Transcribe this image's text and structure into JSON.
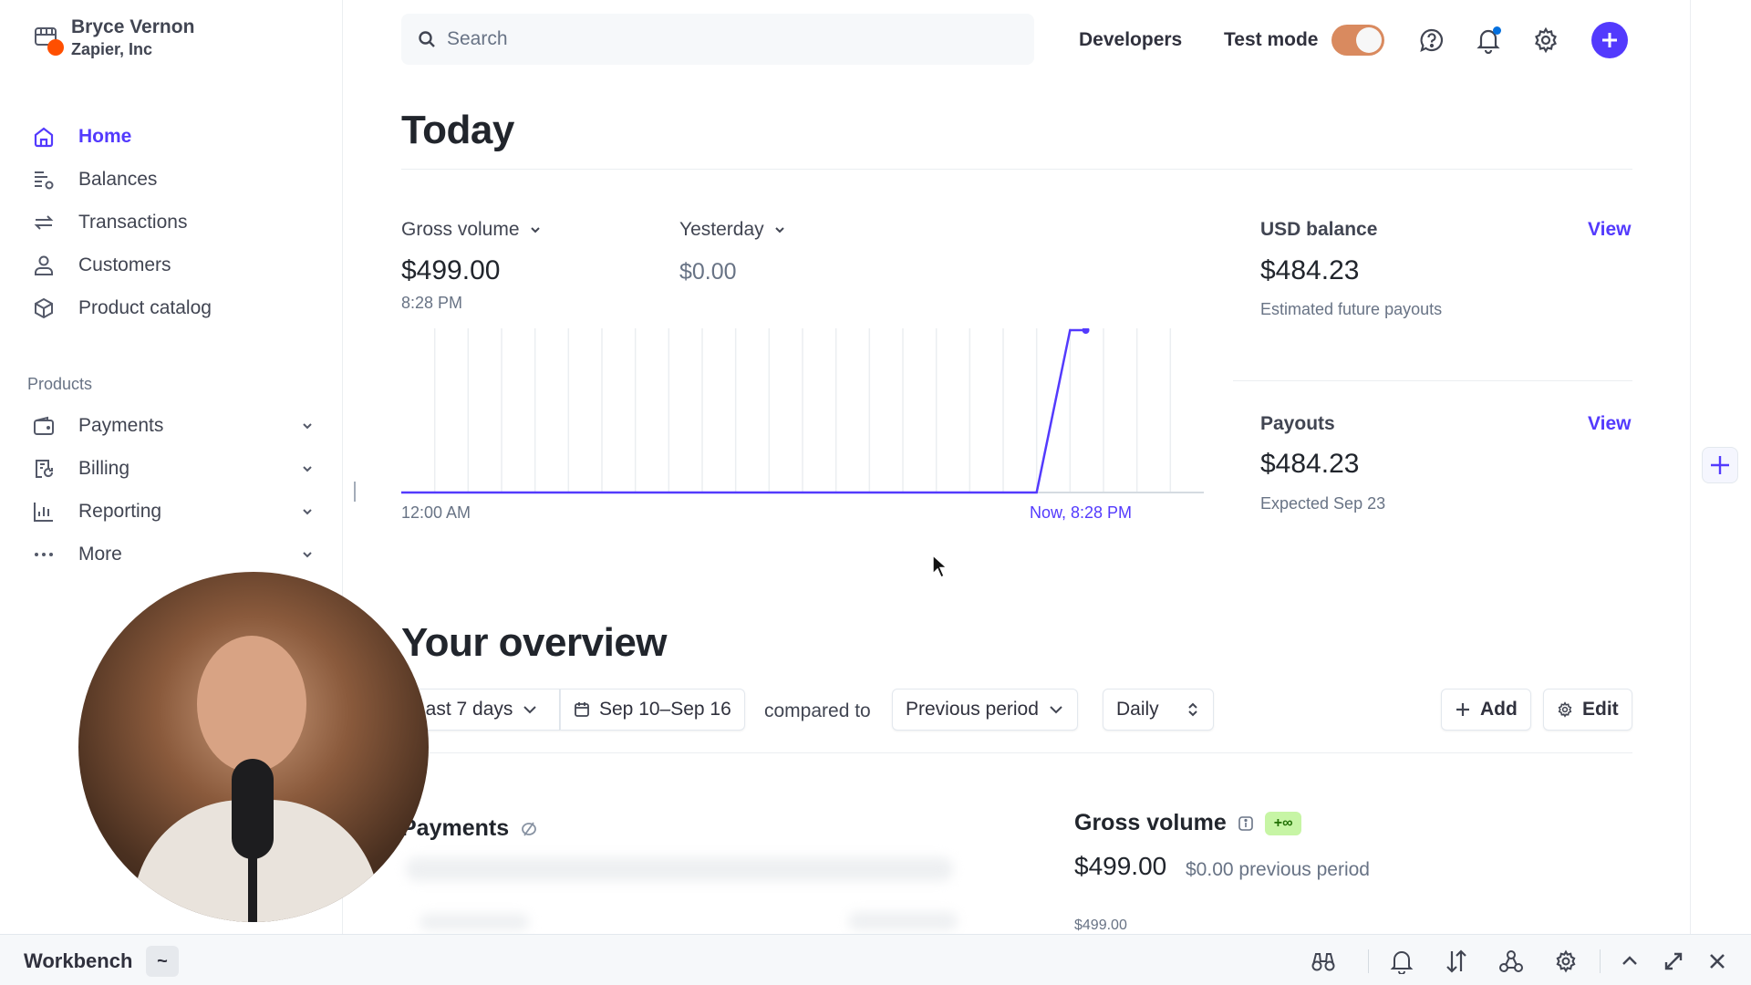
{
  "account": {
    "name": "Bryce Vernon",
    "org": "Zapier, Inc",
    "icon": "store-icon"
  },
  "sidebar": {
    "items": [
      {
        "label": "Home",
        "icon": "home-icon",
        "active": true
      },
      {
        "label": "Balances",
        "icon": "balances-icon"
      },
      {
        "label": "Transactions",
        "icon": "arrows-swap-icon"
      },
      {
        "label": "Customers",
        "icon": "person-icon"
      },
      {
        "label": "Product catalog",
        "icon": "box-icon"
      }
    ],
    "products_label": "Products",
    "products": [
      {
        "label": "Payments",
        "icon": "wallet-icon"
      },
      {
        "label": "Billing",
        "icon": "invoice-icon"
      },
      {
        "label": "Reporting",
        "icon": "bar-chart-icon"
      },
      {
        "label": "More",
        "icon": "more-dots-icon"
      }
    ]
  },
  "topbar": {
    "search_placeholder": "Search",
    "developers": "Developers",
    "test_mode": "Test mode",
    "test_mode_on": true,
    "icons": [
      "help-icon",
      "bell-icon",
      "gear-icon",
      "plus-icon"
    ],
    "accent": "#533afd",
    "toggle_color": "#d98a5f"
  },
  "today": {
    "title": "Today",
    "metric_label": "Gross volume",
    "metric_value": "$499.00",
    "metric_time": "8:28 PM",
    "compare_label": "Yesterday",
    "compare_value": "$0.00",
    "usd_balance": {
      "label": "USD balance",
      "value": "$484.23",
      "sub": "Estimated future payouts",
      "link": "View"
    },
    "payouts": {
      "label": "Payouts",
      "value": "$484.23",
      "sub": "Expected Sep 23",
      "link": "View"
    }
  },
  "chart_data": {
    "type": "line",
    "title": "Gross volume (today)",
    "xlabel": "",
    "ylabel": "",
    "x_tick_labels": [
      "12:00 AM",
      "Now, 8:28 PM"
    ],
    "x_unit": "hour of day",
    "xlim": [
      0,
      24
    ],
    "ylim": [
      0,
      499
    ],
    "grid": "vertical hourly",
    "series": [
      {
        "name": "Gross volume",
        "color": "#533afd",
        "x": [
          0,
          19,
          20,
          20.47
        ],
        "y": [
          0,
          0,
          499,
          499
        ]
      }
    ]
  },
  "overview": {
    "title": "Your overview",
    "range": "Last 7 days",
    "dates": "Sep 10–Sep 16",
    "compared_to": "compared to",
    "comparison": "Previous period",
    "interval": "Daily",
    "add": "Add",
    "edit": "Edit",
    "payments_card": {
      "title": "Payments"
    },
    "gross_card": {
      "title": "Gross volume",
      "badge": "+∞",
      "value": "$499.00",
      "previous": "$0.00 previous period",
      "axis_top": "$499.00"
    }
  },
  "workbench": {
    "title": "Workbench",
    "toggle": "~",
    "icons": [
      "binoculars-icon",
      "bell-icon",
      "sort-arrows-icon",
      "webhook-icon",
      "gear-icon",
      "chevron-up-icon",
      "expand-icon",
      "close-icon"
    ]
  }
}
